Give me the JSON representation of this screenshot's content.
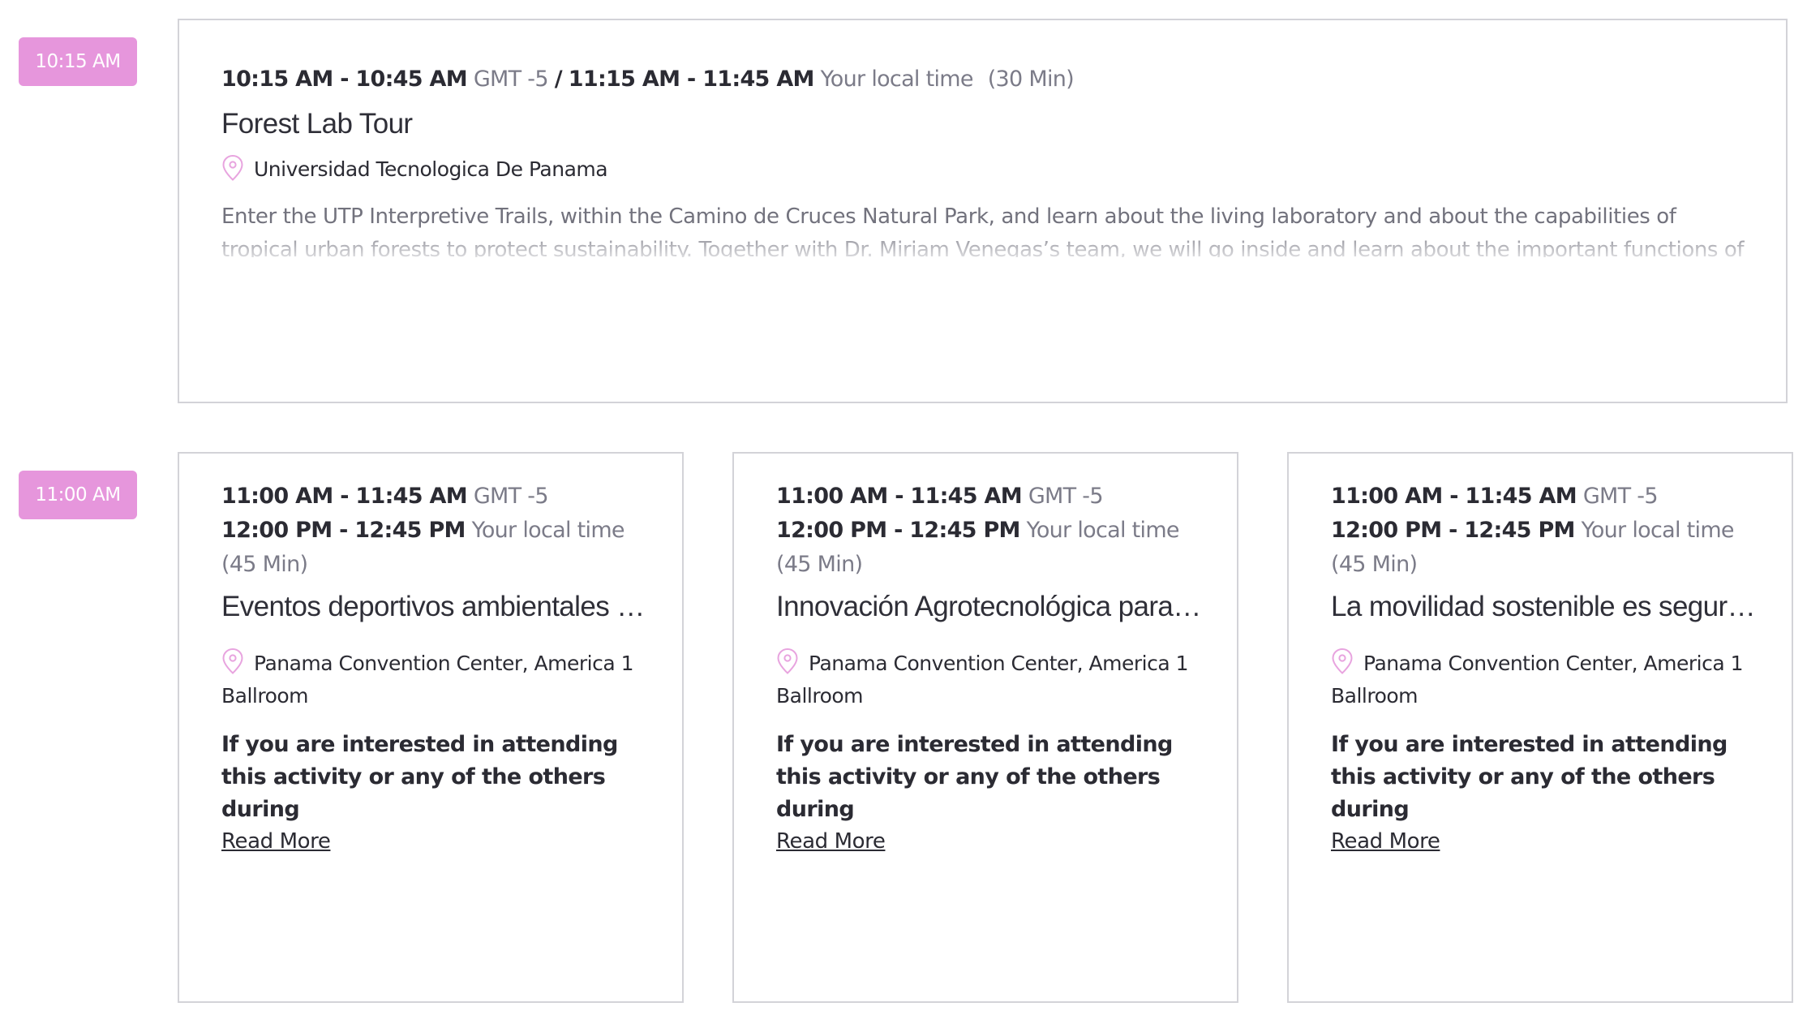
{
  "slots": [
    {
      "badge": "10:15 AM",
      "event": {
        "gmt_range": "10:15 AM - 10:45 AM",
        "gmt_label": "GMT -5",
        "separator": "/",
        "local_range": "11:15 AM - 11:45 AM",
        "local_label": "Your local time",
        "duration": "(30 Min)",
        "title": "Forest Lab Tour",
        "location": "Universidad Tecnologica De Panama",
        "description": "Enter the UTP Interpretive Trails, within the Camino de Cruces Natural Park, and learn about the living laboratory and about the capabilities of tropical urban forests to protect sustainability. Together with Dr. Miriam Venegas’s team, we will go inside and learn about the important functions of the forest, how science"
      }
    },
    {
      "badge": "11:00 AM",
      "events": [
        {
          "gmt_range": "11:00 AM - 11:45 AM",
          "gmt_label": "GMT -5",
          "local_range": "12:00 PM - 12:45 PM",
          "local_label": "Your local time",
          "duration": "(45 Min)",
          "title": "Eventos deportivos ambientales de...",
          "location": "Panama Convention Center, America 1 Ballroom",
          "interest": "If you are interested in attending this activity or any of the others during",
          "read_more": "Read More"
        },
        {
          "gmt_range": "11:00 AM - 11:45 AM",
          "gmt_label": "GMT -5",
          "local_range": "12:00 PM - 12:45 PM",
          "local_label": "Your local time",
          "duration": "(45 Min)",
          "title": "Innovación Agrotecnológica para la...",
          "location": "Panama Convention Center, America 1 Ballroom",
          "interest": "If you are interested in attending this activity or any of the others during",
          "read_more": "Read More"
        },
        {
          "gmt_range": "11:00 AM - 11:45 AM",
          "gmt_label": "GMT -5",
          "local_range": "12:00 PM - 12:45 PM",
          "local_label": "Your local time",
          "duration": "(45 Min)",
          "title": "La movilidad sostenible es segura.....",
          "location": "Panama Convention Center, America 1 Ballroom",
          "interest": "If you are interested in attending this activity or any of the others during",
          "read_more": "Read More"
        }
      ]
    }
  ],
  "colors": {
    "badge_bg": "#e696dc",
    "pin": "#e8a4df",
    "border": "#d3d3d8",
    "muted_text": "#7b7b88"
  },
  "icons": {
    "location": "map-pin-icon"
  }
}
